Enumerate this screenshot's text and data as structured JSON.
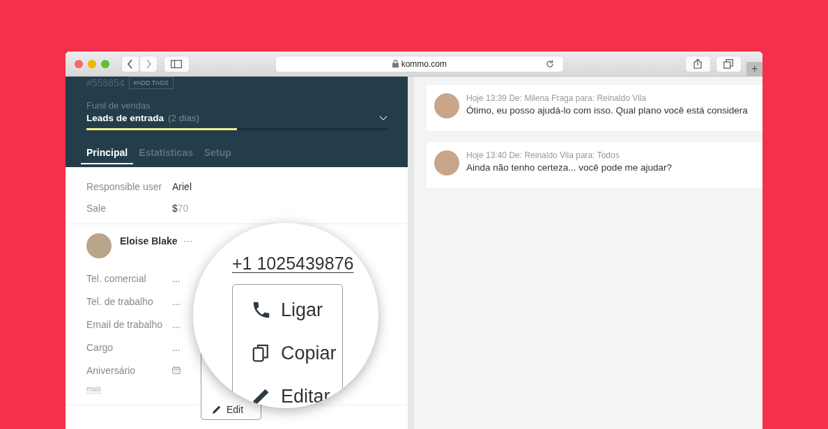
{
  "browser": {
    "address": "kommo.com",
    "new_tab": "+"
  },
  "lead": {
    "id": "#555854",
    "add_tags": "#ADD TAGS",
    "pipeline_label": "Funil de vendas",
    "stage": "Leads de entrada",
    "duration": "(2 dias)",
    "level": 0.5
  },
  "tabs": [
    {
      "label": "Principal",
      "selected": true
    },
    {
      "label": "Estatísticas",
      "selected": false
    },
    {
      "label": "Setup",
      "selected": false
    }
  ],
  "fields": [
    {
      "label": "Responsible user",
      "value": "Ariel"
    },
    {
      "label": "Sale",
      "currency": "$",
      "value": "70"
    }
  ],
  "contact": {
    "name": "Eloise Blake",
    "more": "···",
    "fields": [
      {
        "label": "Tel. comercial",
        "placeholder": "...",
        "kind": "text"
      },
      {
        "label": "Tel. de trabalho",
        "placeholder": "...",
        "kind": "text"
      },
      {
        "label": "Email de trabalho",
        "placeholder": "...",
        "kind": "text"
      },
      {
        "label": "Cargo",
        "placeholder": "...",
        "kind": "text"
      },
      {
        "label": "Aniversário",
        "kind": "date"
      }
    ],
    "more_link": "mais"
  },
  "popup_menu": [
    {
      "label": "Edit",
      "kind": "edit"
    }
  ],
  "magnifier": {
    "phone": "+1 1025439876",
    "menu": [
      {
        "label": "Ligar",
        "kind": "call"
      },
      {
        "label": "Copiar",
        "kind": "copy"
      },
      {
        "label": "Editar",
        "kind": "edit"
      }
    ]
  },
  "messages": [
    {
      "meta": "Hoje 13:39 De: Milena Fraga para: Reinaldo Vila",
      "text": "Ótimo, eu posso ajudá-lo com isso. Qual plano você está considera"
    },
    {
      "meta": "Hoje 13:40 De: Reinaldo Vila para: Todos",
      "text": "Ainda não tenho certeza... você pode me ajudar?"
    }
  ]
}
